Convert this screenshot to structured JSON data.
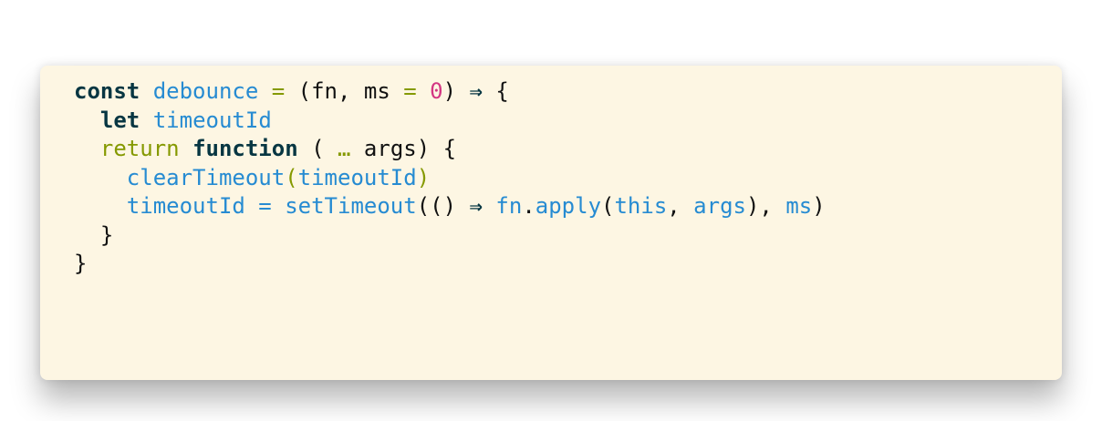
{
  "code": {
    "language": "javascript",
    "colors": {
      "background": "#fdf6e3",
      "keyword": "#073642",
      "identifier": "#268bd2",
      "operator": "#859900",
      "number": "#d33682",
      "plain": "#111111"
    },
    "line1": {
      "t1": "const",
      "t2": " ",
      "t3": "debounce",
      "t4": " ",
      "t5": "=",
      "t6": " (fn, ms ",
      "t7": "=",
      "t8": " ",
      "t9": "0",
      "t10": ") ",
      "t11": "⇒",
      "t12": " {"
    },
    "line2": {
      "t1": "  ",
      "t2": "let",
      "t3": " ",
      "t4": "timeoutId"
    },
    "line3": {
      "t1": "  ",
      "t2": "return",
      "t3": " ",
      "t4": "function",
      "t5": " ( ",
      "t6": "…",
      "t7": " args) {"
    },
    "line4": {
      "t1": "    ",
      "t2": "clearTimeout",
      "t3": "(",
      "t4": "timeoutId",
      "t5": ")"
    },
    "line5": {
      "t1": "    ",
      "t2": "timeoutId",
      "t3": " ",
      "t4": "=",
      "t5": " ",
      "t6": "setTimeout",
      "t7": "(() ",
      "t8": "⇒",
      "t9": " ",
      "t10": "fn",
      "t11": ".",
      "t12": "apply",
      "t13": "(",
      "t14": "this",
      "t15": ", ",
      "t16": "args",
      "t17": "), ",
      "t18": "ms",
      "t19": ")"
    },
    "line6": {
      "t1": "  }"
    },
    "line7": {
      "t1": "}"
    }
  }
}
